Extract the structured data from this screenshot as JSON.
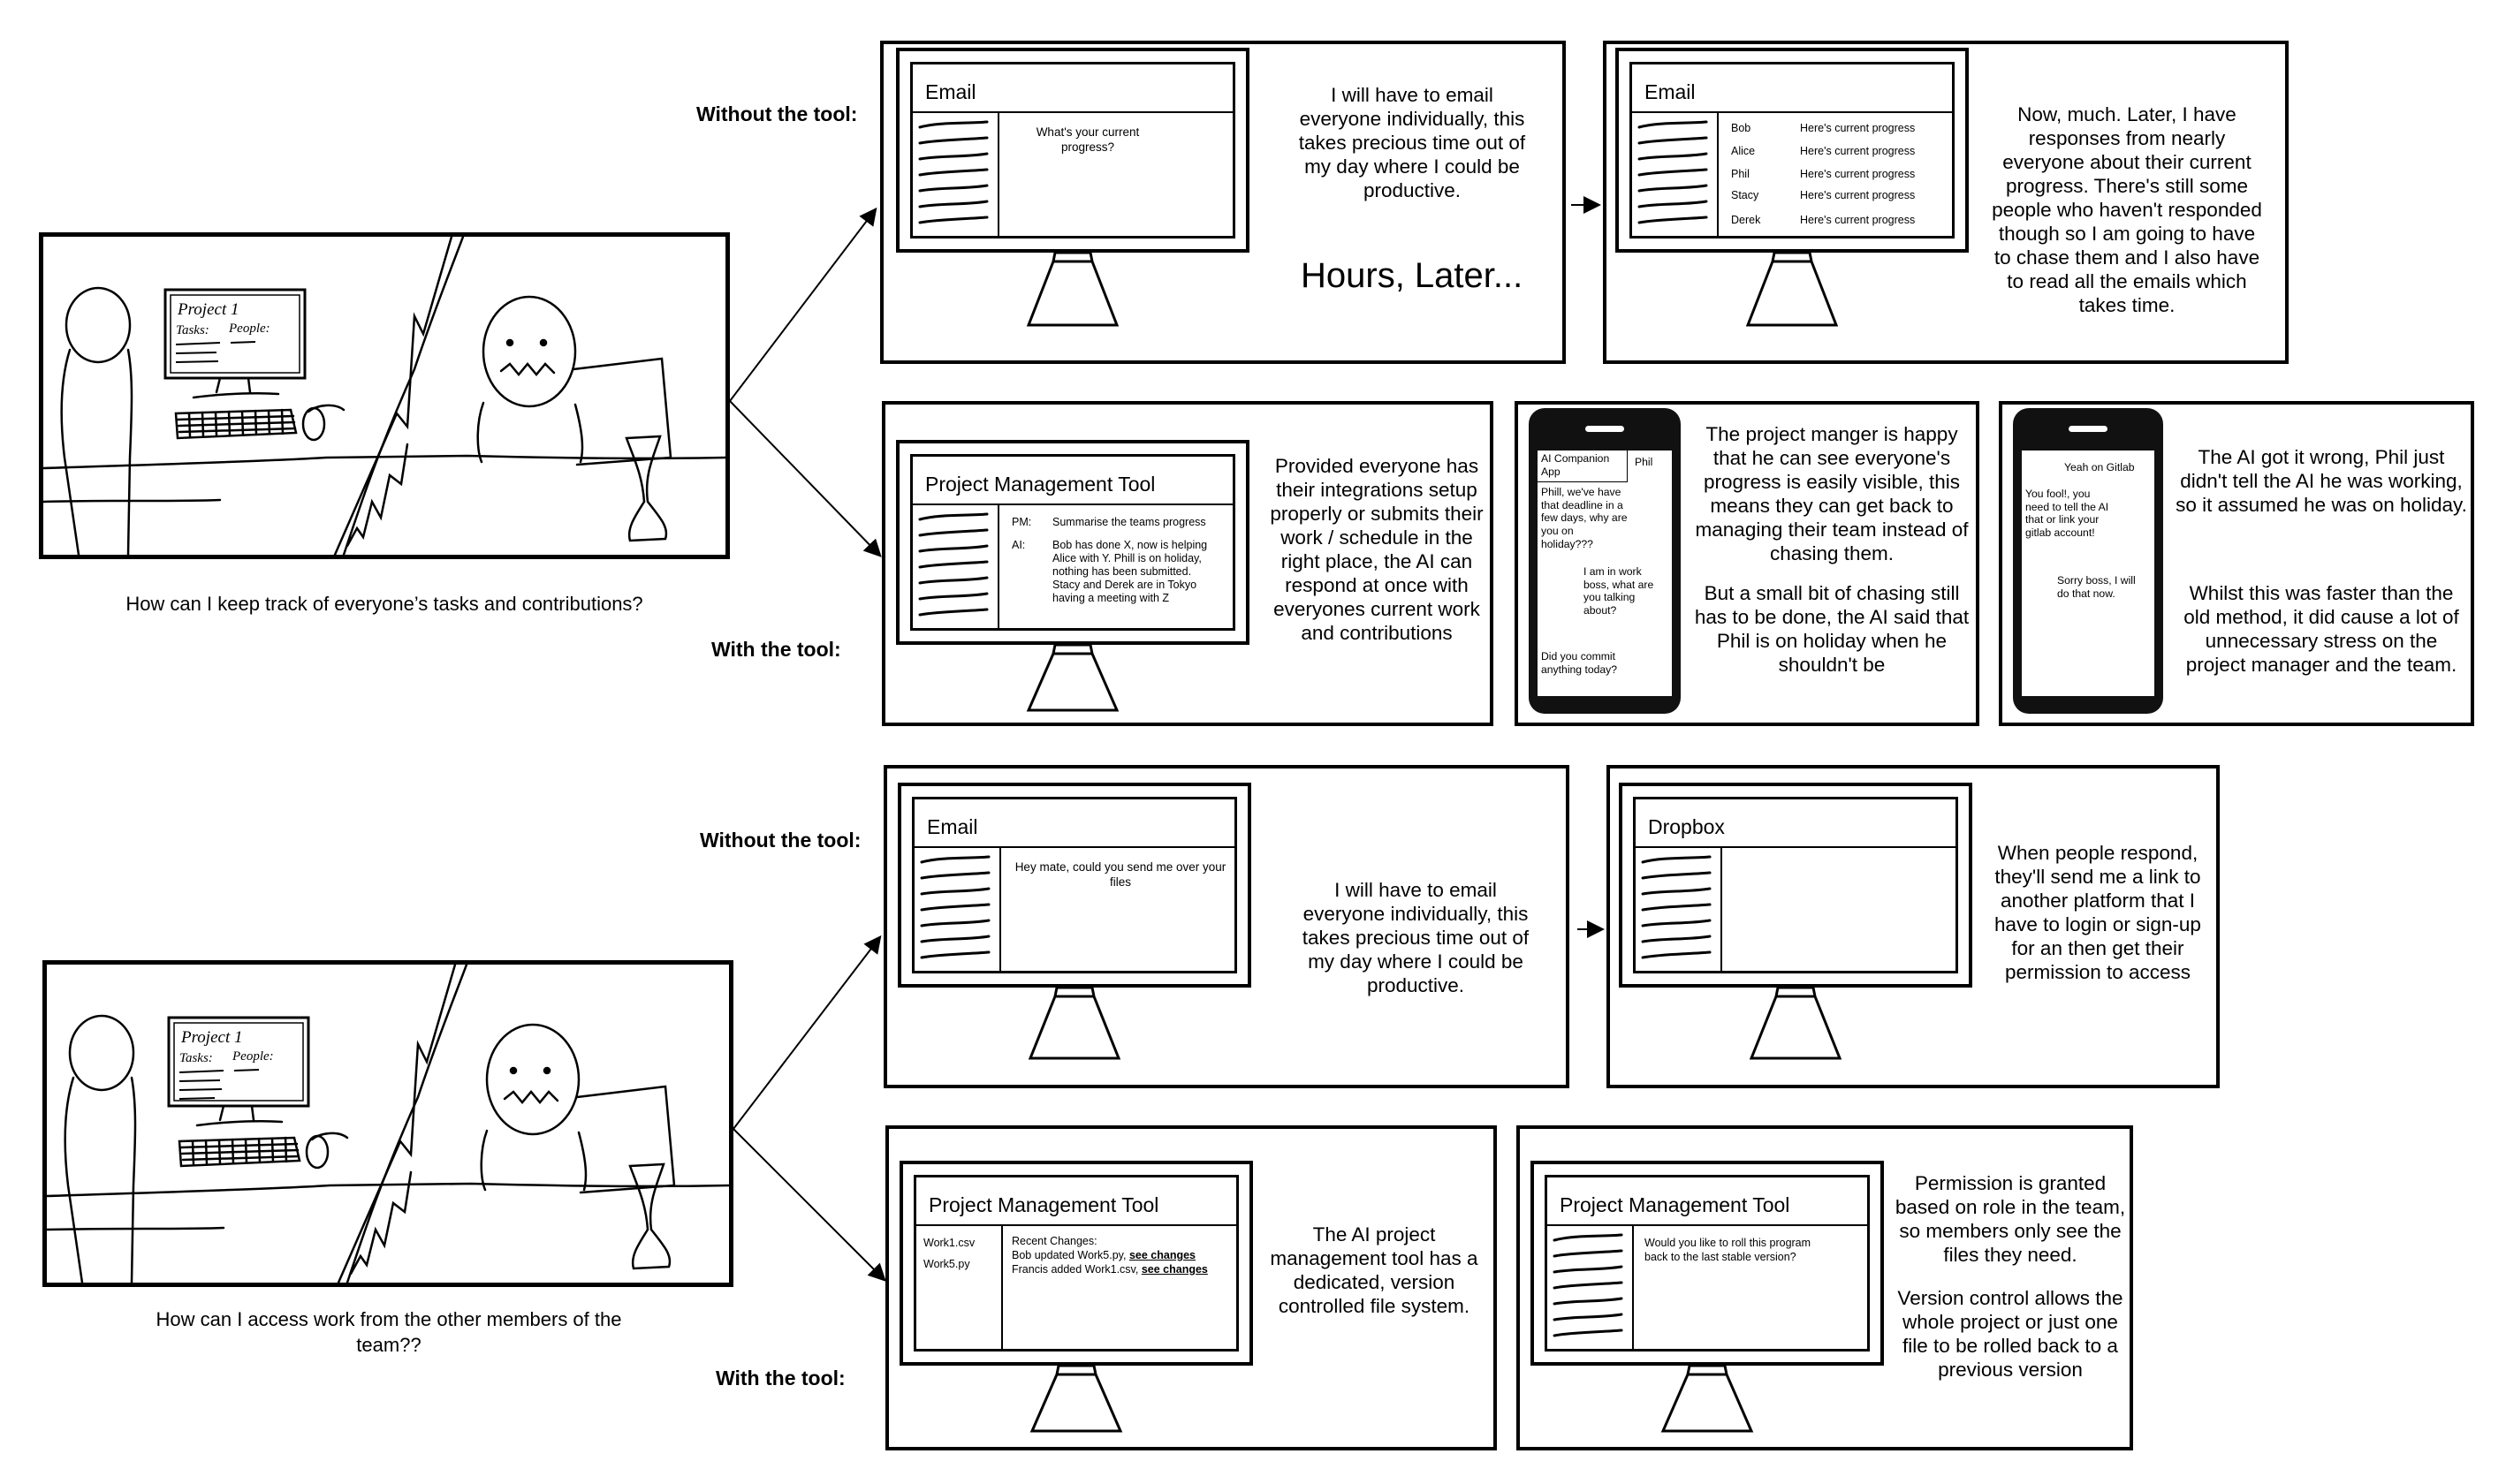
{
  "labels": {
    "without_tool": "Without the tool:",
    "with_tool": "With the tool:"
  },
  "scenario1": {
    "caption": "How can I keep track of everyone’s tasks and contributions?",
    "sketch": {
      "project": "Project 1",
      "tasks": "Tasks:",
      "people": "People:"
    },
    "email_panel": {
      "monitor_title": "Email",
      "message": "What's your current progress?",
      "narration": "I will have to email everyone individually, this takes precious time out of my day where I could be productive.",
      "later": "Hours, Later..."
    },
    "responses_panel": {
      "monitor_title": "Email",
      "rows": [
        {
          "name": "Bob",
          "text": "Here's current progress"
        },
        {
          "name": "Alice",
          "text": "Here's current progress"
        },
        {
          "name": "Phil",
          "text": "Here's current progress"
        },
        {
          "name": "Stacy",
          "text": "Here's current progress"
        },
        {
          "name": "Derek",
          "text": "Here's current progress"
        }
      ],
      "narration": "Now, much. Later, I have responses from nearly everyone about their current progress. There's still some people who haven't responded though so I am going to have to chase them and I also have to read all the emails which takes time."
    },
    "pm_panel": {
      "monitor_title": "Project Management Tool",
      "pm_label": "PM:",
      "pm_text": "Summarise the teams progress",
      "ai_label": "AI:",
      "ai_text": "Bob has done X, now is helping Alice with Y. Phill is on holiday, nothing has been submitted. Stacy and Derek are in Tokyo having a meeting with Z",
      "narration": "Provided everyone has their integrations setup properly or submits their work / schedule in the right place, the AI can respond at once with everyones current work and contributions"
    },
    "phone_panel_1": {
      "app_label": "AI Companion App",
      "contact": "Phil",
      "msg1": "Phill, we've have that deadline in a few days, why are you on holiday???",
      "msg2": "I am in work boss, what are you talking about?",
      "msg3": "Did you commit anything today?",
      "narration_a": "The project manger is happy that he can see everyone's progress is easily visible, this means they can get back to managing their team instead of chasing them.",
      "narration_b": "But a small bit of chasing still has to be done, the AI said that Phil is on holiday when he shouldn't be"
    },
    "phone_panel_2": {
      "msg1": "Yeah on Gitlab",
      "msg2": "You fool!, you need to tell the AI that or link your gitlab account!",
      "msg3": "Sorry boss, I will do that now.",
      "narration_a": "The AI got it wrong, Phil just didn't tell the AI he was working, so it assumed he was on holiday.",
      "narration_b": "Whilst this was faster than the old method, it did cause a lot of unnecessary stress on the project manager and the team."
    }
  },
  "scenario2": {
    "caption": "How can I access work from the other members of the team??",
    "sketch": {
      "project": "Project 1",
      "tasks": "Tasks:",
      "people": "People:"
    },
    "email_panel": {
      "monitor_title": "Email",
      "message": "Hey mate, could you send me over your files",
      "narration": "I will have to email everyone individually, this takes precious time out of my day where I could be productive."
    },
    "dropbox_panel": {
      "monitor_title": "Dropbox",
      "narration": "When people respond, they'll send me a link to another platform that I have to login or sign-up for an then get their permission to access"
    },
    "pm_files_panel": {
      "monitor_title": "Project Management Tool",
      "files": [
        "Work1.csv",
        "Work5.py"
      ],
      "changes_heading": "Recent Changes:",
      "change1_text": "Bob updated Work5.py, ",
      "change1_link": "see changes",
      "change2_text": "Francis added Work1.csv, ",
      "change2_link": "see changes",
      "narration": "The AI project management tool has a dedicated, version controlled file system."
    },
    "rollback_panel": {
      "monitor_title": "Project Management Tool",
      "message": "Would you like to roll this program back to the last stable version?",
      "narration_a": "Permission is granted based on role in the team, so members only see the files they need.",
      "narration_b": "Version control allows the whole project or just one file to be rolled back to a previous version"
    }
  }
}
